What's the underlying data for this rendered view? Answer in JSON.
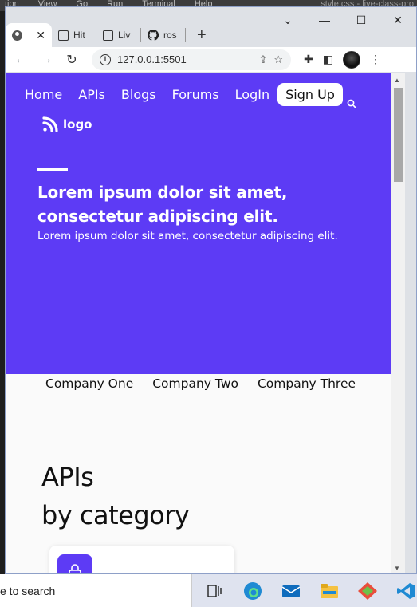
{
  "background_app": {
    "menu": [
      "tion",
      "View",
      "Go",
      "Run",
      "Terminal",
      "Help"
    ],
    "title_fragment": "style.css - live-class-pro"
  },
  "browser": {
    "tabs": [
      {
        "label": "",
        "icon": "globe-icon",
        "active": true
      },
      {
        "label": "Hit",
        "icon": "page-icon",
        "active": false
      },
      {
        "label": "Liv",
        "icon": "page-icon",
        "active": false
      },
      {
        "label": "ros",
        "icon": "github-icon",
        "active": false
      }
    ],
    "new_tab": "+",
    "url": "127.0.0.1:5501",
    "window_controls": {
      "minimize": "⌄",
      "restore": "—",
      "maximize": "☐",
      "close": "✕"
    }
  },
  "page": {
    "nav": {
      "items": [
        "Home",
        "APIs",
        "Blogs",
        "Forums",
        "LogIn"
      ],
      "signup": "Sign Up"
    },
    "logo_text": "logo",
    "headline": "Lorem ipsum dolor sit amet, consectetur adipiscing elit.",
    "subheadline": "Lorem ipsum dolor sit amet, consectetur adipiscing elit.",
    "companies": [
      "Company One",
      "Company Two",
      "Company Three"
    ],
    "section_title_line1": "APIs",
    "section_title_line2": "by category",
    "colors": {
      "brand": "#5d3bf5",
      "page_bg": "#fafafa"
    }
  },
  "taskbar": {
    "search_text": "e to search",
    "apps": [
      "task-view-icon",
      "edge-icon",
      "mail-icon",
      "file-explorer-icon",
      "git-icon",
      "vscode-icon"
    ]
  }
}
